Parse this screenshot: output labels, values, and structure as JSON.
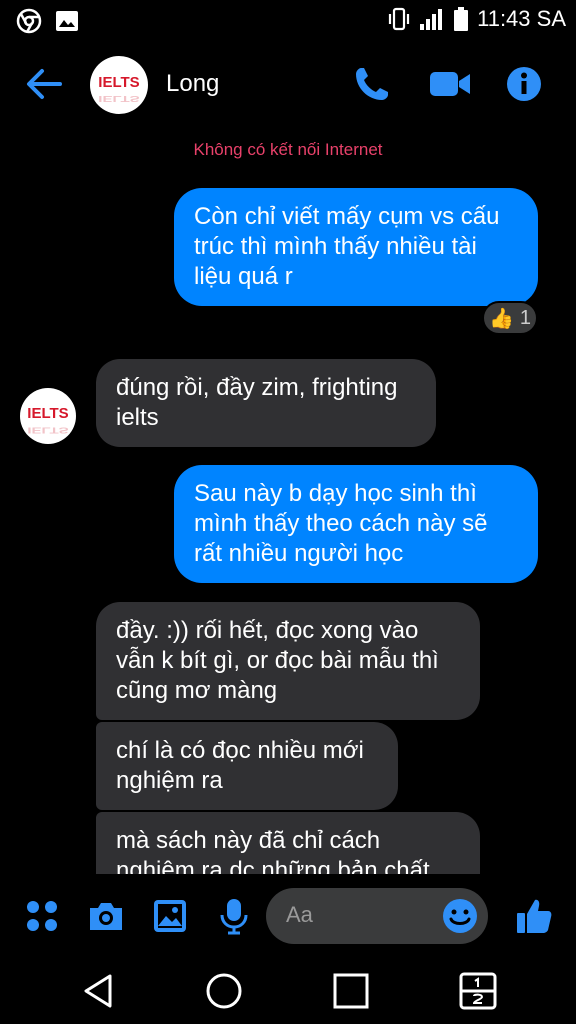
{
  "status_bar": {
    "time": "11:43 SA"
  },
  "header": {
    "contact_name": "Long",
    "avatar_text": "IELTS"
  },
  "banner": {
    "text": "Không có kết nối Internet"
  },
  "messages": [
    {
      "sender": "me",
      "text": "Còn chỉ viết mấy cụm vs cấu trúc thì mình thấy nhiều tài liệu quá r"
    },
    {
      "sender": "them",
      "text": "đúng rồi, đầy zim, frighting ielts"
    },
    {
      "sender": "me",
      "text": "Sau này b dạy học sinh thì mình thấy theo cách này sẽ rất nhiều người học"
    },
    {
      "sender": "them",
      "text": "đầy. :)) rối hết, đọc xong vào vẫn k bít gì, or đọc bài mẫu thì cũng mơ màng"
    },
    {
      "sender": "them",
      "text": "chí là có đọc nhiều mới nghiệm ra"
    },
    {
      "sender": "them",
      "text": "mà sách này đã chỉ cách nghiệm ra dc những bản chất"
    }
  ],
  "reaction": {
    "emoji": "👍",
    "count": "1"
  },
  "composer": {
    "placeholder": "Aa"
  },
  "colors": {
    "accent": "#0084ff",
    "bubble_them": "#303033",
    "warning": "#e8416a"
  }
}
